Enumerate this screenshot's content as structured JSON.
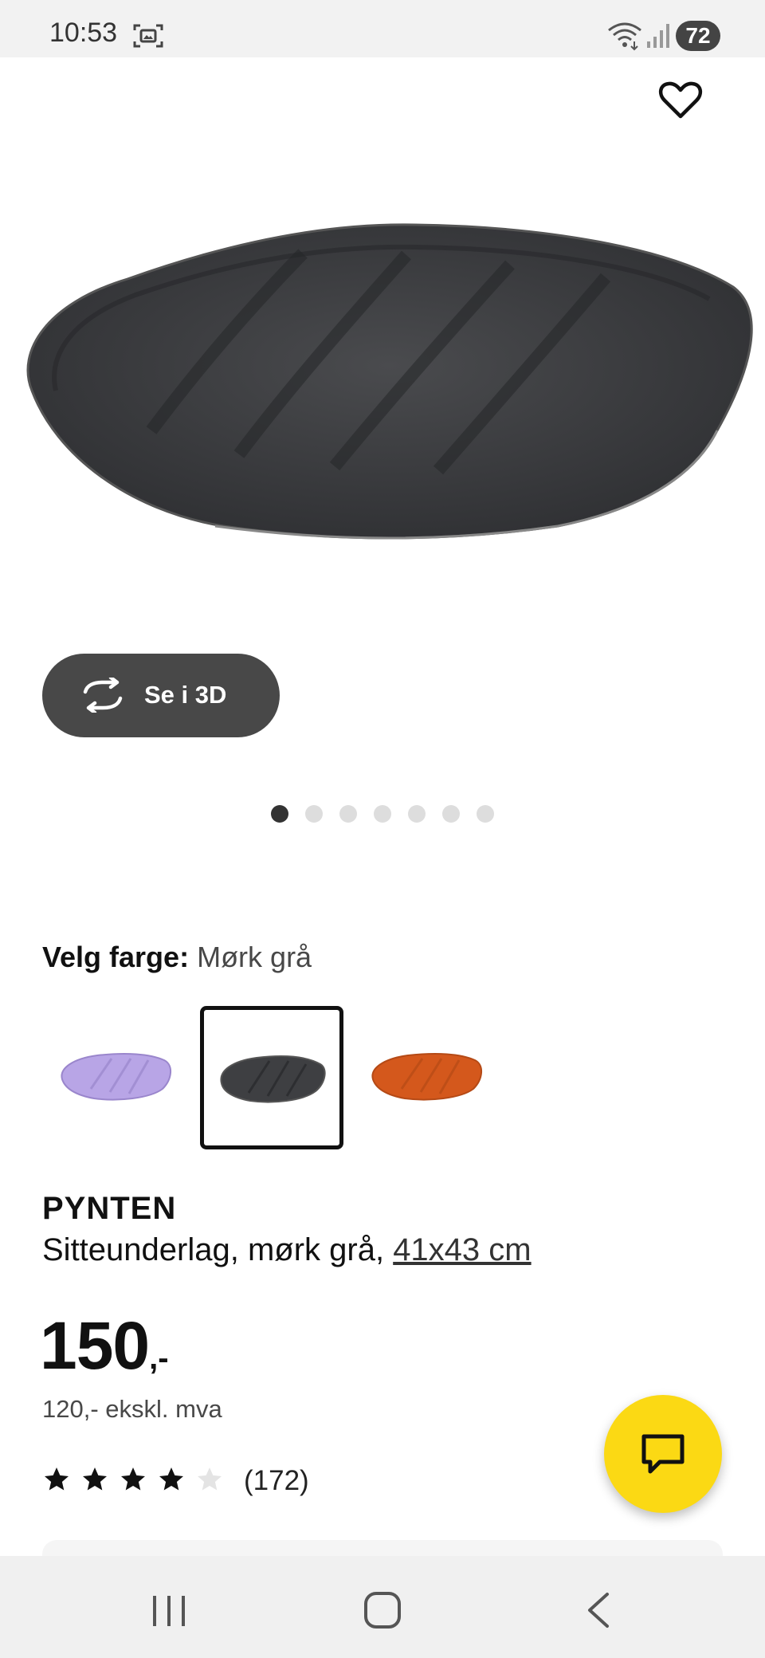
{
  "status_bar": {
    "time": "10:53",
    "battery": "72",
    "icons": [
      "screenshot-icon",
      "wifi-icon",
      "signal-icon"
    ]
  },
  "product": {
    "favorite_icon": "heart-icon",
    "view_3d_label": "Se i 3D",
    "view_3d_icon": "rotate-3d-icon",
    "carousel": {
      "count": 7,
      "active_index": 0
    },
    "color_label_key": "Velg farge:",
    "color_label_value": "Mørk grå",
    "swatches": [
      {
        "name": "Lilla",
        "color": "#b8a5e6",
        "selected": false
      },
      {
        "name": "Mørk grå",
        "color": "#3e3f42",
        "selected": true
      },
      {
        "name": "Oransje",
        "color": "#d4581c",
        "selected": false
      }
    ],
    "name": "PYNTEN",
    "description": "Sitteunderlag, mørk grå,",
    "size": "41x43 cm",
    "price_main": "150",
    "price_suffix": ",-",
    "price_ex_vat": "120,- ekskl. mva",
    "rating": {
      "value": 4,
      "max": 5
    },
    "review_count": "(172)"
  },
  "chat": {
    "icon": "chat-icon",
    "color": "#fbd914"
  },
  "nav_bar": {
    "icons": [
      "recents-icon",
      "home-icon",
      "back-icon"
    ]
  }
}
